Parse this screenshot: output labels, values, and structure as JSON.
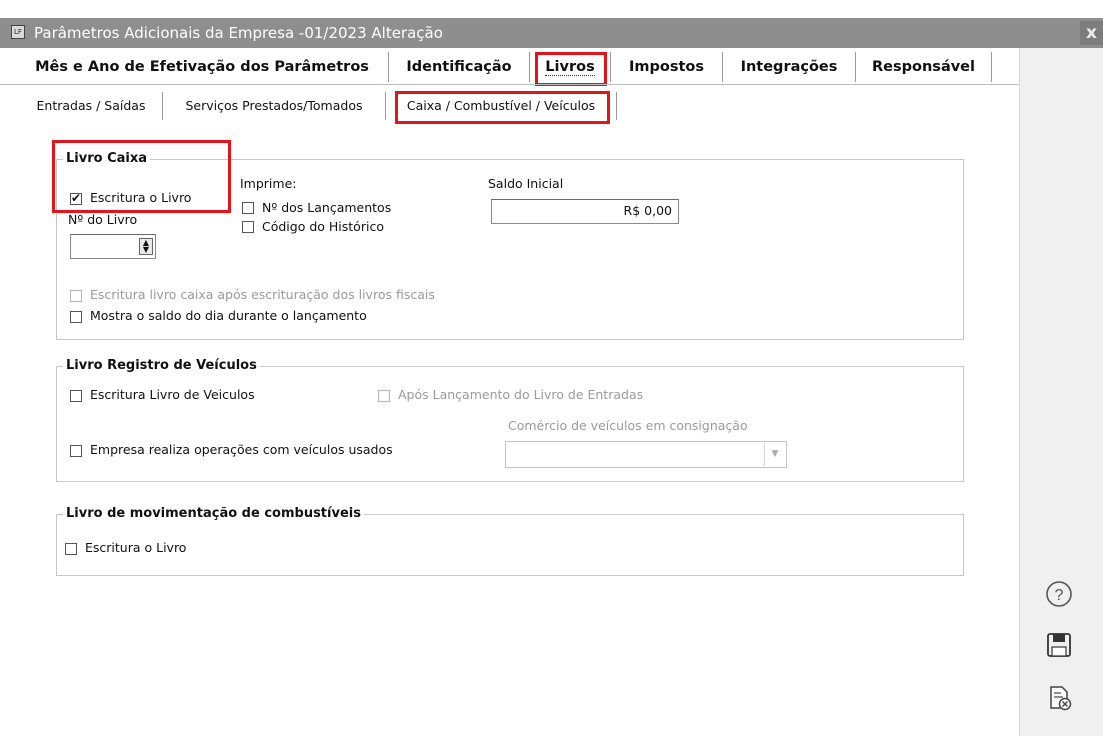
{
  "window": {
    "icon_text": "LF",
    "title": "Parâmetros Adicionais da Empresa -01/2023 Alteração",
    "close_label": "x"
  },
  "main_tabs": [
    {
      "label": "Mês e Ano de Efetivação dos Parâmetros"
    },
    {
      "label": "Identificação"
    },
    {
      "label": "Livros"
    },
    {
      "label": "Impostos"
    },
    {
      "label": "Integrações"
    },
    {
      "label": "Responsável"
    }
  ],
  "sub_tabs": [
    {
      "label": "Entradas / Saídas"
    },
    {
      "label": "Serviços Prestados/Tomados"
    },
    {
      "label": "Caixa / Combustível / Veículos"
    }
  ],
  "livro_caixa": {
    "legend": "Livro Caixa",
    "escritura_label": "Escritura o Livro",
    "escritura_checked": true,
    "imprime_label": "Imprime:",
    "lancamentos_label": "Nº dos Lançamentos",
    "historico_label": "Código do Histórico",
    "numero_livro_label": "Nº do Livro",
    "numero_livro_value": "",
    "saldo_inicial_label": "Saldo Inicial",
    "saldo_inicial_value": "R$ 0,00",
    "apos_fiscais_label": "Escritura livro caixa após escrituração dos livros fiscais",
    "mostra_saldo_label": "Mostra o saldo do dia durante o lançamento"
  },
  "livro_veiculos": {
    "legend": "Livro Registro de Veículos",
    "escritura_label": "Escritura Livro de Veiculos",
    "apos_entradas_label": "Após Lançamento do Livro de Entradas",
    "usados_label": "Empresa realiza operações com veículos usados",
    "consignacao_label": "Comércio de veículos em consignação",
    "consignacao_value": ""
  },
  "livro_combustiveis": {
    "legend": "Livro de movimentação de combustíveis",
    "escritura_label": "Escritura o Livro"
  },
  "side_buttons": [
    {
      "icon": "help-icon"
    },
    {
      "icon": "save-icon"
    },
    {
      "icon": "cancel-document-icon"
    }
  ],
  "colors": {
    "highlight": "#e2161a",
    "titlebar": "#8e8e8e"
  }
}
